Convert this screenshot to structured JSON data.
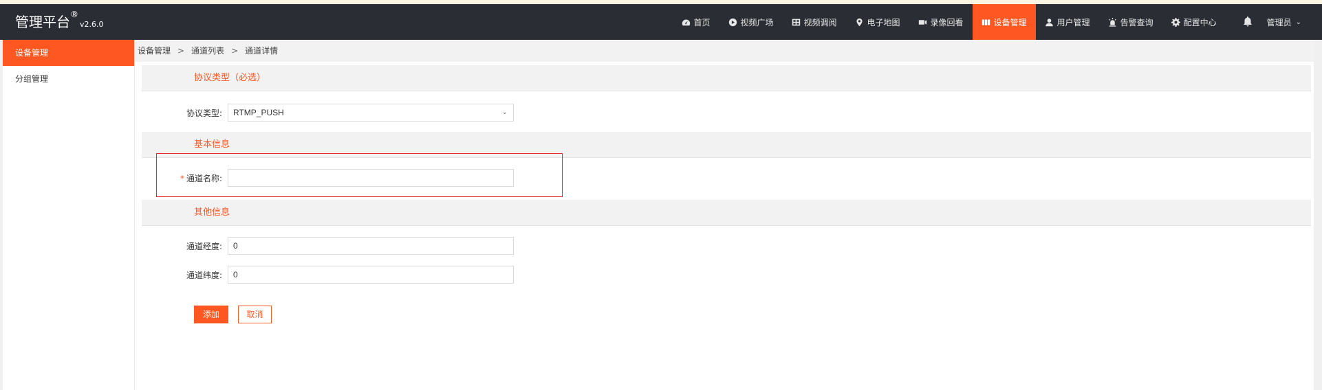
{
  "app": {
    "title": "管理平台",
    "registered": "®",
    "version": "v2.6.0"
  },
  "nav": [
    {
      "label": "首页",
      "icon": "dashboard-icon",
      "active": false
    },
    {
      "label": "视频广场",
      "icon": "play-circle-icon",
      "active": false
    },
    {
      "label": "视频调阅",
      "icon": "grid-icon",
      "active": false
    },
    {
      "label": "电子地图",
      "icon": "location-pin-icon",
      "active": false
    },
    {
      "label": "录像回看",
      "icon": "video-camera-icon",
      "active": false
    },
    {
      "label": "设备管理",
      "icon": "device-icon",
      "active": true
    },
    {
      "label": "用户管理",
      "icon": "user-icon",
      "active": false
    },
    {
      "label": "告警查询",
      "icon": "alarm-icon",
      "active": false
    },
    {
      "label": "配置中心",
      "icon": "gear-icon",
      "active": false
    }
  ],
  "user": {
    "name": "管理员"
  },
  "sidebar": {
    "items": [
      {
        "label": "设备管理",
        "active": true
      },
      {
        "label": "分组管理",
        "active": false
      }
    ]
  },
  "breadcrumb": {
    "items": [
      "设备管理",
      "通道列表",
      "通道详情"
    ],
    "separator": ">"
  },
  "form": {
    "section_protocol": "协议类型（必选）",
    "protocol_label": "协议类型:",
    "protocol_value": "RTMP_PUSH",
    "section_basic": "基本信息",
    "required_mark": "*",
    "name_label": "通道名称:",
    "name_value": "",
    "section_other": "其他信息",
    "longitude_label": "通道经度:",
    "longitude_value": "0",
    "latitude_label": "通道纬度:",
    "latitude_value": "0",
    "add_button": "添加",
    "cancel_button": "取消"
  },
  "colors": {
    "accent": "#ff5722",
    "header_bg": "#2a2e34",
    "highlight_border": "#e52828"
  }
}
